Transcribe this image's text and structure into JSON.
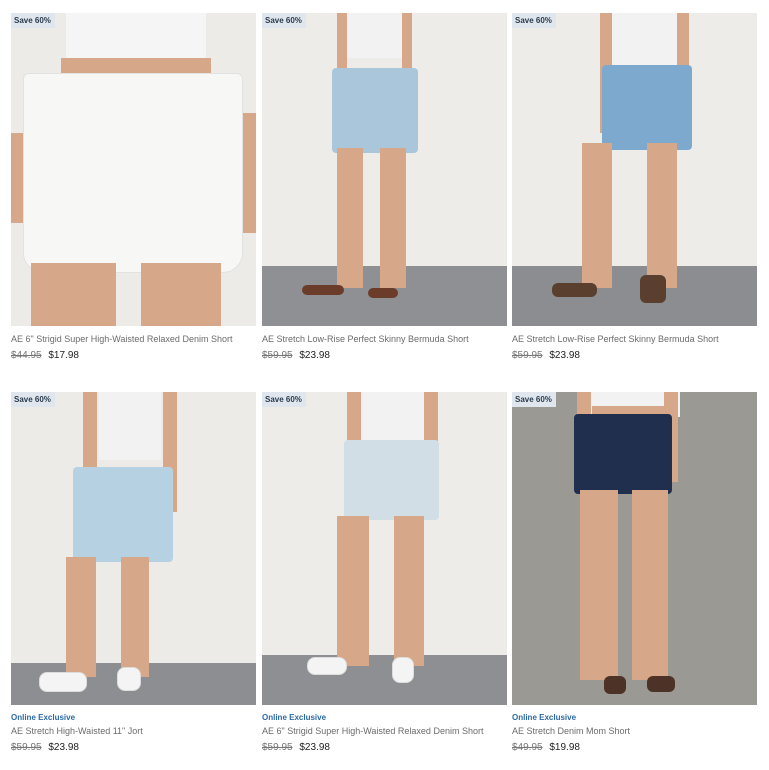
{
  "products": [
    {
      "badge": "Save 60%",
      "exclusive": "",
      "name": "AE 6\" Strigid Super High-Waisted Relaxed Denim Short",
      "original_price": "$44.95",
      "sale_price": "$17.98"
    },
    {
      "badge": "Save 60%",
      "exclusive": "",
      "name": "AE Stretch Low-Rise Perfect Skinny Bermuda Short",
      "original_price": "$59.95",
      "sale_price": "$23.98"
    },
    {
      "badge": "Save 60%",
      "exclusive": "",
      "name": "AE Stretch Low-Rise Perfect Skinny Bermuda Short",
      "original_price": "$59.95",
      "sale_price": "$23.98"
    },
    {
      "badge": "Save 60%",
      "exclusive": "Online Exclusive",
      "name": "AE Stretch High-Waisted 11\" Jort",
      "original_price": "$59.95",
      "sale_price": "$23.98"
    },
    {
      "badge": "Save 60%",
      "exclusive": "Online Exclusive",
      "name": "AE 6\" Strigid Super High-Waisted Relaxed Denim Short",
      "original_price": "$59.95",
      "sale_price": "$23.98"
    },
    {
      "badge": "Save 60%",
      "exclusive": "Online Exclusive",
      "name": "AE Stretch Denim Mom Short",
      "original_price": "$49.95",
      "sale_price": "$19.98"
    }
  ]
}
